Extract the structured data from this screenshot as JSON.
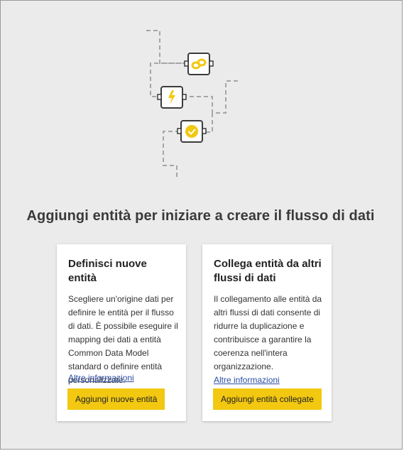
{
  "headline": "Aggiungi entità per iniziare a creare il flusso di dati",
  "cards": [
    {
      "title": "Definisci nuove entità",
      "body": "Scegliere un'origine dati per definire le entità per il flusso di dati. È possibile eseguire il mapping dei dati a entità Common Data Model standard o definire entità personalizzate.",
      "link": "Altre informazioni",
      "button": "Aggiungi nuove entità"
    },
    {
      "title": "Collega entità da altri flussi di dati",
      "body": "Il collegamento alle entità da altri flussi di dati consente di ridurre la duplicazione e contribuisce a garantire la coerenza nell'intera organizzazione.",
      "link": "Altre informazioni",
      "button": "Aggiungi entità collegate"
    }
  ],
  "colors": {
    "accent": "#f2c811",
    "background": "#ebebeb",
    "link": "#2b4ea3"
  },
  "icons": [
    "link-icon",
    "lightning-icon",
    "checkmark-badge-icon"
  ]
}
